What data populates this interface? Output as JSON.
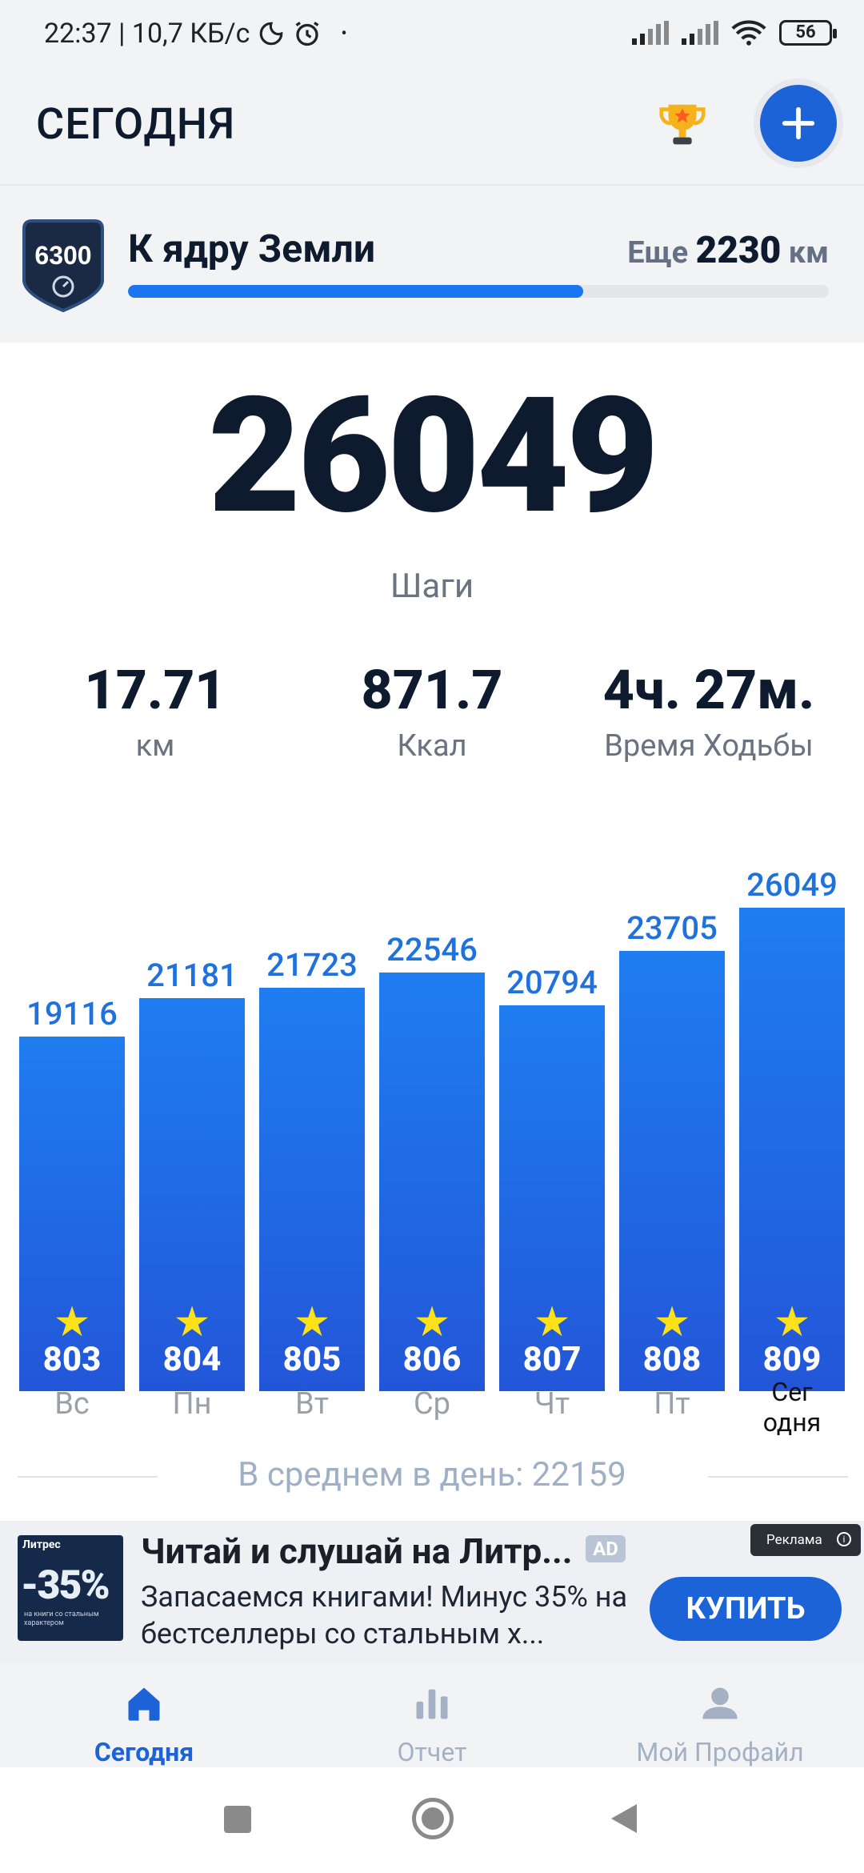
{
  "status_bar": {
    "time_speed": "22:37 | 10,7 КБ/с",
    "battery": "56"
  },
  "header": {
    "title": "СЕГОДНЯ"
  },
  "goal": {
    "badge_number": "6300",
    "title": "К ядру Земли",
    "remaining_prefix": "Еще",
    "remaining_value": "2230",
    "remaining_unit": "км",
    "progress": 0.65
  },
  "today": {
    "steps": "26049",
    "steps_label": "Шаги",
    "distance_value": "17.71",
    "distance_label": "км",
    "calories_value": "871.7",
    "calories_label": "Ккал",
    "time_value": "4ч. 27м.",
    "time_label": "Время Ходьбы"
  },
  "chart_data": {
    "type": "bar",
    "categories": [
      "Вс",
      "Пн",
      "Вт",
      "Ср",
      "Чт",
      "Пт",
      "Сег одня"
    ],
    "values": [
      19116,
      21181,
      21723,
      22546,
      20794,
      23705,
      26049
    ],
    "bar_labels": [
      "803",
      "804",
      "805",
      "806",
      "807",
      "808",
      "809"
    ],
    "title": "",
    "xlabel": "",
    "ylabel": "",
    "ylim": [
      0,
      26049
    ],
    "colors": {
      "bar_top": "#1f7df0",
      "bar_bottom": "#2256d8",
      "value_text": "#1f72dd",
      "star": "#ffe11a"
    }
  },
  "chart": {
    "days": [
      "Вс",
      "Пн",
      "Вт",
      "Ср",
      "Чт",
      "Пт"
    ],
    "today_line1": "Сег",
    "today_line2": "одня",
    "average_text": "В среднем в день: 22159"
  },
  "ad": {
    "image_brand": "Литрес",
    "image_percent": "-35%",
    "image_subtitle": "на книги со стальным характером",
    "title": "Читай и слушай на Литр...",
    "tag": "AD",
    "text": "Запасаемся книгами! Минус 35% на бестселлеры со стальным х...",
    "chip": "Реклама",
    "chip_icon": "i",
    "button": "КУПИТЬ"
  },
  "nav": {
    "today": "Сегодня",
    "report": "Отчет",
    "profile": "Мой Профайл"
  }
}
